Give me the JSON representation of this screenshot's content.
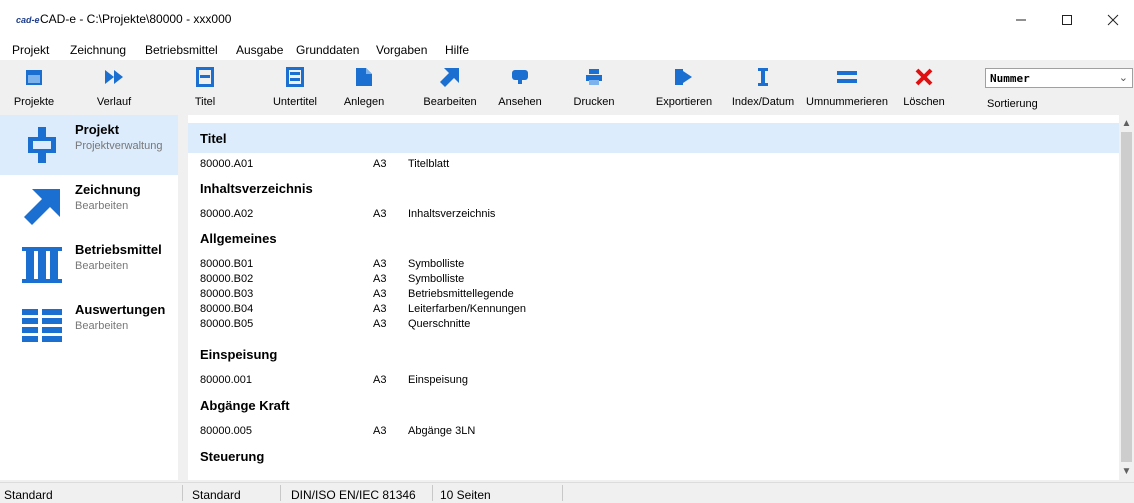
{
  "window": {
    "logo": "cad-e",
    "title": "CAD-e - C:\\Projekte\\80000 - xxx000"
  },
  "menu": [
    "Projekt",
    "Zeichnung",
    "Betriebsmittel",
    "Ausgabe",
    "Grunddaten",
    "Vorgaben",
    "Hilfe"
  ],
  "toolbar": {
    "projekte": "Projekte",
    "verlauf": "Verlauf",
    "titel": "Titel",
    "untertitel": "Untertitel",
    "anlegen": "Anlegen",
    "bearbeiten": "Bearbeiten",
    "ansehen": "Ansehen",
    "drucken": "Drucken",
    "exportieren": "Exportieren",
    "index": "Index/Datum",
    "umnummerieren": "Umnummerieren",
    "loeschen": "Löschen"
  },
  "sort": {
    "value": "Nummer",
    "label": "Sortierung"
  },
  "sidebar": [
    {
      "title": "Projekt",
      "sub": "Projektverwaltung"
    },
    {
      "title": "Zeichnung",
      "sub": "Bearbeiten"
    },
    {
      "title": "Betriebsmittel",
      "sub": "Bearbeiten"
    },
    {
      "title": "Auswertungen",
      "sub": "Bearbeiten"
    }
  ],
  "sections": [
    {
      "title": "Titel",
      "rows": [
        {
          "num": "80000.A01",
          "fmt": "A3",
          "name": "Titelblatt"
        }
      ]
    },
    {
      "title": "Inhaltsverzeichnis",
      "rows": [
        {
          "num": "80000.A02",
          "fmt": "A3",
          "name": "Inhaltsverzeichnis"
        }
      ]
    },
    {
      "title": "Allgemeines",
      "rows": [
        {
          "num": "80000.B01",
          "fmt": "A3",
          "name": "Symbolliste"
        },
        {
          "num": "80000.B02",
          "fmt": "A3",
          "name": "Symbolliste"
        },
        {
          "num": "80000.B03",
          "fmt": "A3",
          "name": "Betriebsmittellegende"
        },
        {
          "num": "80000.B04",
          "fmt": "A3",
          "name": "Leiterfarben/Kennungen"
        },
        {
          "num": "80000.B05",
          "fmt": "A3",
          "name": "Querschnitte"
        }
      ]
    },
    {
      "title": "Einspeisung",
      "rows": [
        {
          "num": "80000.001",
          "fmt": "A3",
          "name": "Einspeisung"
        }
      ]
    },
    {
      "title": "Abgänge Kraft",
      "rows": [
        {
          "num": "80000.005",
          "fmt": "A3",
          "name": "Abgänge 3LN"
        }
      ]
    },
    {
      "title": "Steuerung",
      "rows": []
    }
  ],
  "status": [
    "Standard",
    "Standard",
    "DIN/ISO EN/IEC 81346",
    "10 Seiten"
  ],
  "colors": {
    "accent": "#1a6fd1",
    "highlight": "#dcecfc",
    "delete": "#e01010"
  },
  "icons": {
    "minimize": "minimize-icon",
    "maximize": "maximize-icon",
    "close": "close-icon",
    "scroll_up": "▲",
    "scroll_down": "▼",
    "dropdown": "⌄"
  }
}
